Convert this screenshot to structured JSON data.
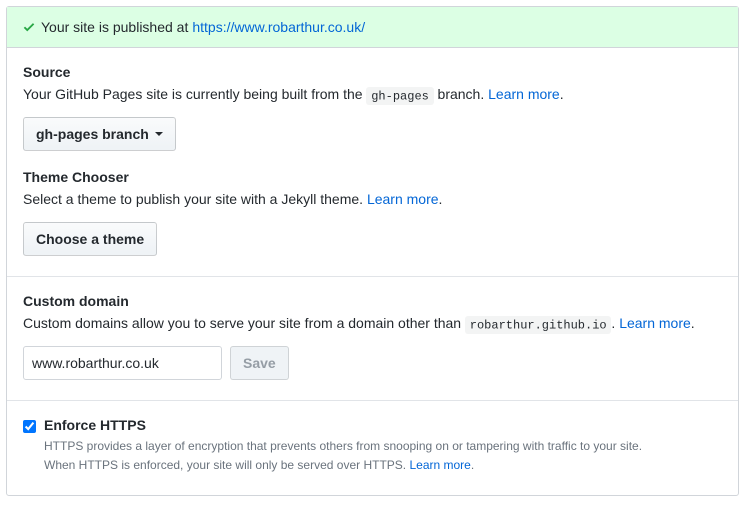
{
  "flash": {
    "prefix": "Your site is published at",
    "url": "https://www.robarthur.co.uk/"
  },
  "source": {
    "heading": "Source",
    "desc_before": "Your GitHub Pages site is currently being built from the ",
    "branch_code": "gh-pages",
    "desc_after": " branch. ",
    "learn_more": "Learn more",
    "button": "gh-pages branch"
  },
  "theme": {
    "heading": "Theme Chooser",
    "desc": "Select a theme to publish your site with a Jekyll theme. ",
    "learn_more": "Learn more",
    "button": "Choose a theme"
  },
  "custom_domain": {
    "heading": "Custom domain",
    "desc_before": "Custom domains allow you to serve your site from a domain other than ",
    "default_domain": "robarthur.github.io",
    "desc_after": ". ",
    "learn_more": "Learn more",
    "input_value": "www.robarthur.co.uk",
    "save": "Save"
  },
  "https": {
    "heading": "Enforce HTTPS",
    "line1": "HTTPS provides a layer of encryption that prevents others from snooping on or tampering with traffic to your site.",
    "line2_prefix": "When HTTPS is enforced, your site will only be served over HTTPS. ",
    "learn_more": "Learn more"
  }
}
